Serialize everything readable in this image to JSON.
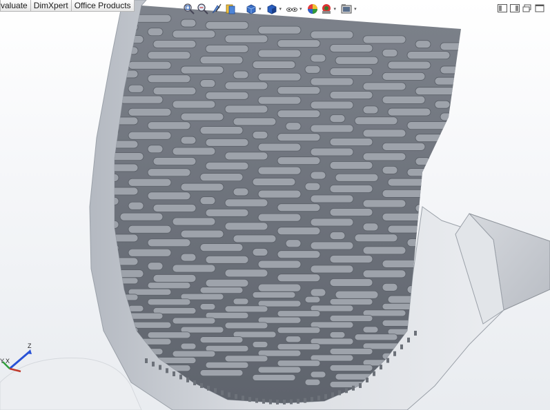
{
  "command_tabs": [
    "valuate",
    "DimXpert",
    "Office Products"
  ],
  "heads_up_toolbar": {
    "icons": [
      "zoom-to-fit-icon",
      "zoom-to-area-icon",
      "previous-view-icon",
      "section-view-icon",
      "view-orientation-icon",
      "display-style-icon",
      "hide-show-items-icon",
      "edit-appearance-icon",
      "apply-scene-icon",
      "view-settings-icon"
    ]
  },
  "window_controls": [
    "tile-left-icon",
    "tile-right-icon",
    "restore-icon",
    "maximize-icon"
  ],
  "triad": {
    "x_label": "X",
    "y_label": "Y",
    "z_label": "Z"
  },
  "colors": {
    "viewport_top": "#ffffff",
    "viewport_bottom": "#e9ecf0",
    "model_face": "#a9adb6",
    "slot": "#7a7f89",
    "axis_x": "#c0392b",
    "axis_y": "#2e9e3a",
    "axis_z": "#2952d6"
  }
}
